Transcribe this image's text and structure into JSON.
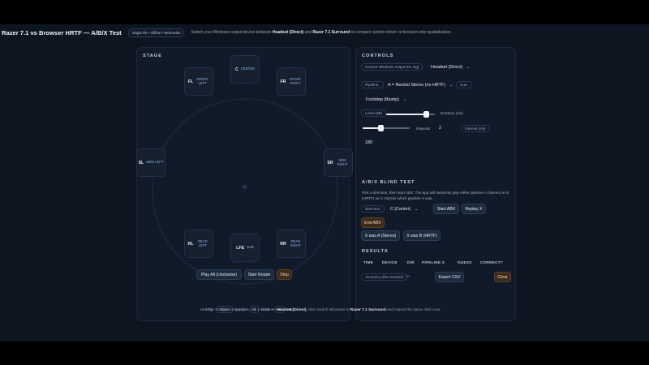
{
  "header": {
    "title": "Razer 7.1 vs Browser HRTF — A/B/X Test",
    "badge": "Single file • Offline • WebAudio",
    "instr_pre": "Switch your Windows output device between ",
    "instr_b1": "Headset (Direct)",
    "instr_mid": " and ",
    "instr_b2": "Razer 7.1 Surround",
    "instr_post": " to compare system driver vs browser-only spatialization."
  },
  "stage": {
    "heading": "STAGE",
    "speakers": [
      {
        "code": "C",
        "name": "CENTER"
      },
      {
        "code": "FL",
        "name": "FRONT LEFT"
      },
      {
        "code": "FR",
        "name": "FRONT RIGHT"
      },
      {
        "code": "SL",
        "name": "SIDE LEFT"
      },
      {
        "code": "SR",
        "name": "SIDE RIGHT"
      },
      {
        "code": "RL",
        "name": "REAR LEFT"
      },
      {
        "code": "LFE",
        "name": "SUB"
      },
      {
        "code": "RR",
        "name": "REAR RIGHT"
      }
    ],
    "buttons": {
      "play_all": "Play All (clockwise)",
      "start_rotate": "Start Rotate",
      "stop": "Stop"
    },
    "hotkeys": {
      "label": "Hotkeys:",
      "k1": "Space",
      "t1": "repeat •",
      "k2": "R",
      "t2": "rotate •",
      "k3": "S",
      "t3": "stop"
    }
  },
  "controls": {
    "heading": "CONTROLS",
    "output_label": "Current Windows output (for log)",
    "output_value": "Headset (Direct)",
    "pipeline_label": "Pipeline:",
    "pipeline_value": "A = Neutral Stereo (no HRTF)",
    "cue_label": "Cue:",
    "cue_value": "Footstep (thump)",
    "level_label": "Level (dB)",
    "level_value": 0.82,
    "duration_label": "Duration (ms)",
    "duration_value": 0.38,
    "repeats_label": "Repeats",
    "repeats_value": "2",
    "interval_label": "Interval (ms)",
    "interval_value": "180"
  },
  "abx": {
    "heading": "A/B/X BLIND TEST",
    "description": "Pick a direction, then start ABX. The app will randomly play either pipeline A (Stereo) or B (HRTF) as X. Decide which pipeline X was.",
    "direction_label": "Direction:",
    "direction_value": "C (Center)",
    "start": "Start ABX",
    "replay": "Replay X",
    "end": "End ABX",
    "x_was_a": "X was A (Stereo)",
    "x_was_b": "X was B (HRTF)"
  },
  "results": {
    "heading": "RESULTS",
    "columns": [
      "TIME",
      "DEVICE",
      "DIR",
      "PIPELINE X",
      "GUESS",
      "CORRECT?"
    ],
    "accuracy_label": "Accuracy (this session)",
    "accuracy_value": "—",
    "export": "Export CSV",
    "clear": "Clear"
  },
  "footer": {
    "tip_pre": "Tip: For fair comparison, run a block on ",
    "tip_b1": "Headset (Direct)",
    "tip_mid": ", then switch Windows to ",
    "tip_b2": "Razer 7.1 Surround",
    "tip_post": " and repeat the same ABX runs."
  },
  "colors": {
    "background": "#0d1520",
    "panel": "#111a28",
    "accent": "#8fb2e6",
    "stop_button": "#3b2a17"
  }
}
